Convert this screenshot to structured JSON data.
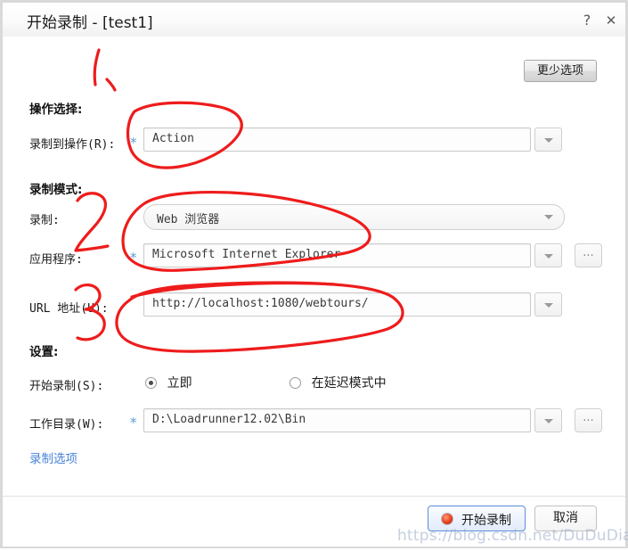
{
  "window": {
    "title": "开始录制 - [test1]",
    "help_icon": "?",
    "close_icon": "✕"
  },
  "toolbar": {
    "less_options_label": "更少选项"
  },
  "sections": {
    "action_selection": "操作选择:",
    "record_mode": "录制模式:",
    "settings": "设置:"
  },
  "fields": {
    "record_into_action": {
      "label": "录制到操作(R):",
      "required_mark": "*",
      "value": "Action"
    },
    "record": {
      "label": "录制:",
      "value": "Web 浏览器"
    },
    "application": {
      "label": "应用程序:",
      "required_mark": "*",
      "value": "Microsoft Internet Explorer",
      "browse_label": "..."
    },
    "url_address": {
      "label": "URL 地址(U):",
      "value": "http://localhost:1080/webtours/"
    },
    "start_recording_mode": {
      "label": "开始录制(S):",
      "option_immediate": "立即",
      "option_delayed": "在延迟模式中",
      "selected": "立即"
    },
    "working_directory": {
      "label": "工作目录(W):",
      "required_mark": "*",
      "value": "D:\\Loadrunner12.02\\Bin",
      "browse_label": "..."
    }
  },
  "links": {
    "recording_options": "录制选项"
  },
  "footer": {
    "start_label": "开始录制",
    "cancel_label": "取消"
  },
  "watermark": {
    "text": "https://blog.csdn.net/DuDuDian"
  },
  "annotations": {
    "marks": [
      "stroke",
      "circle-1",
      "digit-2",
      "circle-2",
      "digit-3",
      "circle-3"
    ],
    "color": "#ee1c1c"
  },
  "colors": {
    "accent_link": "#4a84d8",
    "required_star": "#5b9bd5",
    "annotation_red": "#ee1c1c",
    "record_dot": "#e8401c"
  }
}
